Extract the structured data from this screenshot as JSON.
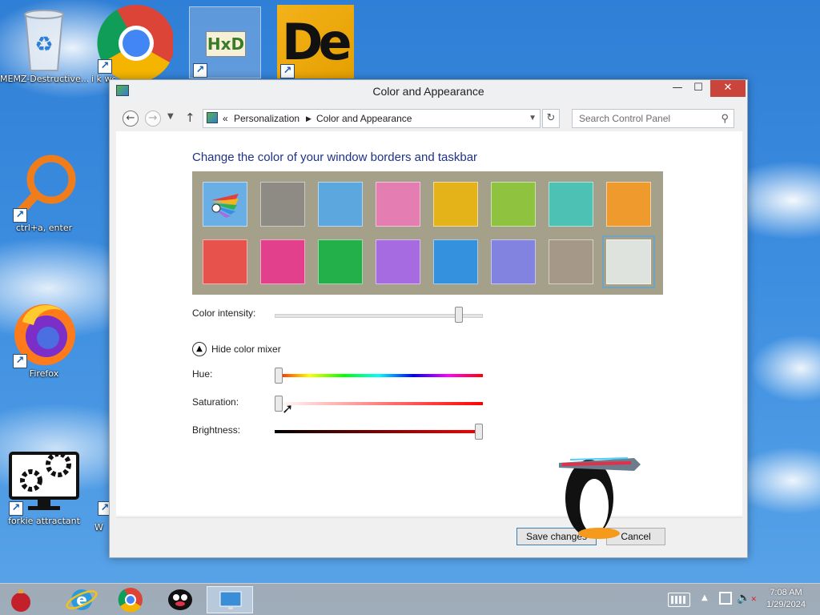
{
  "desktop": {
    "icons": [
      {
        "label": "MEMZ-Destructive...",
        "icon": "recycle-bin-icon"
      },
      {
        "label": "i k we",
        "icon": "chrome-icon"
      },
      {
        "label": "",
        "icon": "hxd-icon"
      },
      {
        "label": "",
        "icon": "de-app-icon"
      },
      {
        "label": "ctrl+a, enter",
        "icon": "magnifier-icon"
      },
      {
        "label": "Firefox",
        "icon": "firefox-icon"
      },
      {
        "label": "forkie attractant",
        "icon": "settings-monitor-icon"
      },
      {
        "label": "W",
        "icon": "generic-app-icon"
      }
    ]
  },
  "window": {
    "title": "Color and Appearance",
    "controls": {
      "minimize": "—",
      "maximize": "☐",
      "close": "✕"
    },
    "address": {
      "prefix": "«",
      "crumbs": [
        "Personalization",
        "Color and Appearance"
      ],
      "separator": "›"
    },
    "search_placeholder": "Search Control Panel",
    "heading": "Change the color of your window borders and taskbar",
    "swatches": [
      {
        "color": "automatic",
        "label": ""
      },
      {
        "color": "#8e8b85"
      },
      {
        "color": "#5ba7de"
      },
      {
        "color": "#e37db2"
      },
      {
        "color": "#e3b319"
      },
      {
        "color": "#8fc23e"
      },
      {
        "color": "#4cc1b4"
      },
      {
        "color": "#ef9a2c"
      },
      {
        "color": "#e8524d"
      },
      {
        "color": "#e23f8c"
      },
      {
        "color": "#23b04b"
      },
      {
        "color": "#a76be1"
      },
      {
        "color": "#3391dd"
      },
      {
        "color": "#8282e0"
      },
      {
        "color": "#a69888"
      },
      {
        "color": "#dfe3de"
      }
    ],
    "selected_swatch_index": 15,
    "intensity_label": "Color intensity:",
    "intensity_value": 0.9,
    "mixer_toggle_label": "Hide color mixer",
    "hue_label": "Hue:",
    "hue_value": 0.0,
    "saturation_label": "Saturation:",
    "saturation_value": 0.0,
    "brightness_label": "Brightness:",
    "brightness_value": 1.0,
    "save_label": "Save changes",
    "cancel_label": "Cancel"
  },
  "taskbar": {
    "items": [
      "ornament-icon",
      "internet-explorer-icon",
      "chrome-icon",
      "penguin-app-icon",
      "control-panel-icon"
    ],
    "tray": [
      "keyboard-icon",
      "chevron-up-icon",
      "network-icon",
      "volume-muted-icon"
    ],
    "time": "7:08 AM",
    "date": "1/29/2024"
  }
}
